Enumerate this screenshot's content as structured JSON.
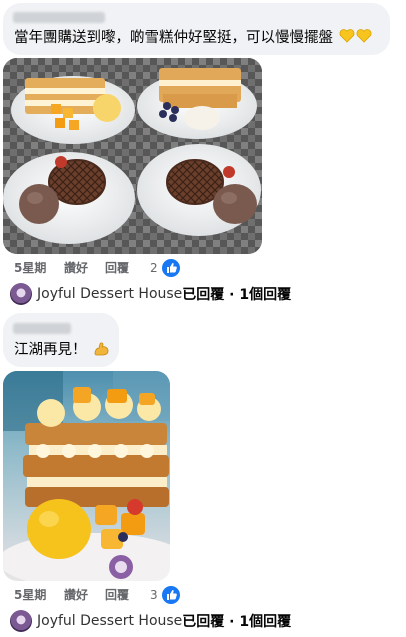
{
  "comments": [
    {
      "text": "當年團購送到嚟，啲雪糕仲好堅挺，可以慢慢擺盤",
      "emoji_icon": "yellow-heart-icon",
      "time": "5星期",
      "like_label": "讚好",
      "reply_label": "回覆",
      "like_count": "2",
      "reply_author": "Joyful Dessert House",
      "reply_suffix": "已回覆 · 1個回覆"
    },
    {
      "text": "江湖再見！",
      "emoji_icon": "flexed-biceps-icon",
      "time": "5星期",
      "like_label": "讚好",
      "reply_label": "回覆",
      "like_count": "3",
      "reply_author": "Joyful Dessert House",
      "reply_suffix": "已回覆 · 1個回覆"
    }
  ],
  "colors": {
    "bubble": "#f0f2f5",
    "meta_text": "#65676b",
    "like_blue": "#1877f2"
  }
}
